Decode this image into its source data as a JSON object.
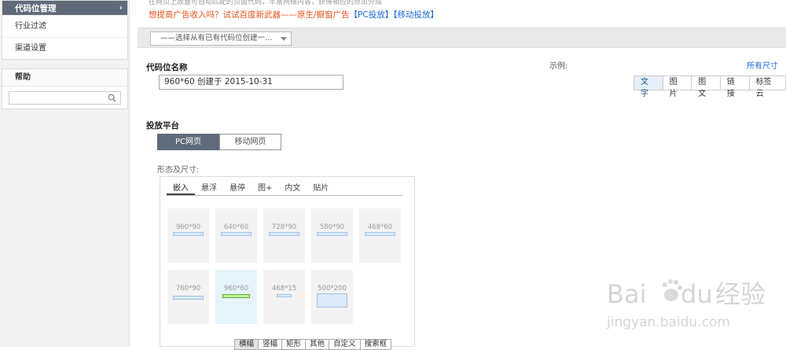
{
  "sidebar": {
    "header": "代码位管理",
    "header_arrow": "›",
    "items": [
      {
        "label": "行业过滤"
      },
      {
        "label": "渠道设置"
      }
    ],
    "help": {
      "title": "帮助",
      "search_placeholder": ""
    }
  },
  "main": {
    "top_clipped_text": "在网页上放置可自动匹配的页面代码，丰富网络内容，获得相应的点击分成",
    "promo": {
      "text": "想提高广告收入吗？试试百度新武器——原生/橱窗广告",
      "pc_link": "【PC投放】",
      "mobile_link": "【移动投放】"
    },
    "copy_select": {
      "value": "——选择从有已有代码位创建一…"
    },
    "code_name_label": "代码位名称",
    "code_name_value": "960*60 创建于 2015-10-31",
    "example_label": "示例:",
    "all_sizes_link": "所有尺寸",
    "example_types": [
      {
        "label": "文字",
        "active": true
      },
      {
        "label": "图片",
        "active": false
      },
      {
        "label": "图文",
        "active": false
      },
      {
        "label": "链接",
        "active": false
      },
      {
        "label": "标签云",
        "active": false
      }
    ],
    "platform_label": "投放平台",
    "platform_buttons": [
      {
        "label": "PC网页",
        "active": true
      },
      {
        "label": "移动网页",
        "active": false
      }
    ],
    "shape_label": "形态及尺寸:",
    "form_tabs": [
      {
        "label": "嵌入",
        "active": true
      },
      {
        "label": "悬浮",
        "active": false
      },
      {
        "label": "悬停",
        "active": false
      },
      {
        "label": "图+",
        "active": false
      },
      {
        "label": "内文",
        "active": false
      },
      {
        "label": "贴片",
        "active": false
      }
    ],
    "sizes": [
      {
        "label": "960*90",
        "selected": false
      },
      {
        "label": "640*60",
        "selected": false
      },
      {
        "label": "728*90",
        "selected": false
      },
      {
        "label": "580*90",
        "selected": false
      },
      {
        "label": "468*60",
        "selected": false
      },
      {
        "label": "760*90",
        "selected": false
      },
      {
        "label": "960*60",
        "selected": true
      },
      {
        "label": "468*15",
        "selected": false
      },
      {
        "label": "500*200",
        "selected": false
      }
    ],
    "size_filters": [
      {
        "label": "横幅",
        "active": true
      },
      {
        "label": "竖幅",
        "active": false
      },
      {
        "label": "矩形",
        "active": false
      },
      {
        "label": "其他",
        "active": false
      },
      {
        "label": "自定义",
        "active": false
      },
      {
        "label": "搜索框",
        "active": false
      }
    ]
  },
  "watermark": {
    "brand": "Bai",
    "brand2": "du",
    "cn": "经验",
    "url": "jingyan.baidu.com"
  },
  "colors": {
    "sidebar_header": "#5f6b7a",
    "promo": "#e8541e",
    "link": "#1a6bd6",
    "selected_tile": "#e5f3fb",
    "green_bar": "#5db130"
  }
}
